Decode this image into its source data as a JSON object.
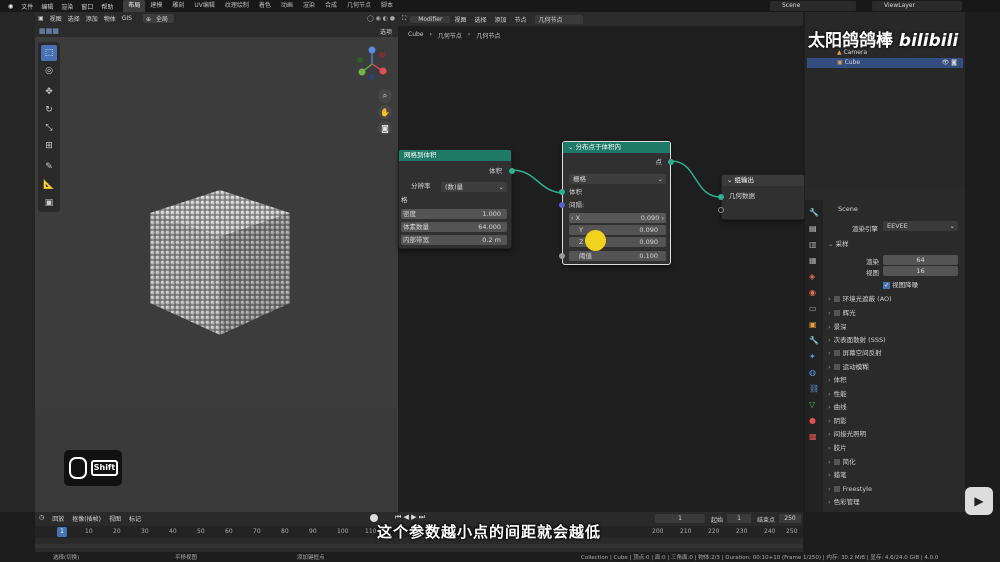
{
  "topbar": {
    "menu": [
      "文件",
      "编辑",
      "渲染",
      "窗口",
      "帮助"
    ],
    "workspaces": [
      "布局",
      "建模",
      "雕刻",
      "UV编辑",
      "纹理绘制",
      "着色",
      "动画",
      "渲染",
      "合成",
      "几何节点",
      "脚本"
    ],
    "active_workspace": "布局",
    "scene": "Scene",
    "view_layer": "ViewLayer"
  },
  "viewport": {
    "menu": [
      "视图",
      "选择",
      "添加",
      "物体",
      "GIS"
    ],
    "mode": "全局",
    "options": "选项"
  },
  "node_editor": {
    "editor_type": "Modifier",
    "menu": [
      "视图",
      "选择",
      "添加",
      "节点"
    ],
    "tree_name": "几何节点",
    "breadcrumb": [
      "Cube",
      "几何节点",
      "几何节点"
    ],
    "node_mesh_to_volume": {
      "title": "网格到体积",
      "output": "体积",
      "resolution_label": "分辨率",
      "resolution_value": "(数)量",
      "section": "格",
      "density_label": "密度",
      "density_value": "1.000",
      "voxel_label": "体素数量",
      "voxel_value": "64.000",
      "band_label": "内部带宽",
      "band_value": "0.2 m"
    },
    "node_distribute": {
      "title": "分布点于体积内",
      "output": "点",
      "mode": "栅格",
      "input_volume": "体积",
      "spacing_label": "间隔:",
      "x_label": "X",
      "x_value": "0.090",
      "y_label": "Y",
      "y_value": "0.090",
      "z_label": "Z",
      "z_value": "0.090",
      "threshold_label": "阈值",
      "threshold_value": "0.100"
    },
    "node_output": {
      "title": "组输出",
      "input": "几何数据"
    }
  },
  "outliner": {
    "items": [
      {
        "label": "Camera"
      },
      {
        "label": "Cube"
      }
    ]
  },
  "properties": {
    "scene": "Scene",
    "engine_label": "渲染引擎",
    "engine_value": "EEVEE",
    "sampling": "采样",
    "render_label": "渲染",
    "render_value": "64",
    "viewport_label": "视图",
    "viewport_value": "16",
    "denoise": "视图降噪",
    "panels": [
      "环境光遮蔽 (AO)",
      "辉光",
      "景深",
      "次表面散射 (SSS)",
      "屏幕空间反射",
      "运动模糊",
      "体积",
      "性能",
      "曲线",
      "阴影",
      "间接光照明",
      "胶片",
      "简化",
      "蜡笔",
      "Freestyle",
      "色彩管理"
    ]
  },
  "timeline": {
    "menu": [
      "回放",
      "抠像(插帧)",
      "视图",
      "标记"
    ],
    "current_frame": "1",
    "start_label": "起始",
    "start_value": "1",
    "end_label": "结束点",
    "end_value": "250",
    "ticks": [
      "1",
      "10",
      "20",
      "30",
      "40",
      "50",
      "60",
      "70",
      "80",
      "90",
      "100",
      "110",
      "200",
      "210",
      "220",
      "230",
      "240",
      "250"
    ]
  },
  "status": {
    "left1": "选择(切换)",
    "left2": "平移视图",
    "left3": "添加键框点",
    "right": "Collection | Cube | 顶点:0 | 面:0 | 三角面:0 | 物体:2/3 | Duration: 00:10+10 (Frame 1/250) | 内存: 30.2 MiB | 显存: 4.6/24.0 GiB | 4.0.0"
  },
  "overlay": {
    "subtitle": "这个参数越小点的间距就会越低",
    "watermark": "太阳鸽鸽棒",
    "key_label": "Shift"
  }
}
